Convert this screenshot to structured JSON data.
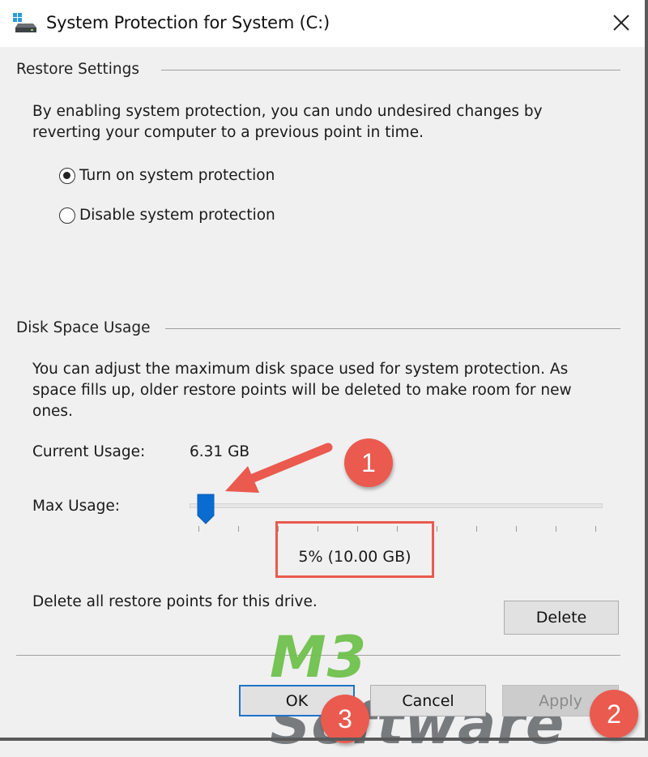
{
  "window": {
    "title": "System Protection for System (C:)",
    "icon": "drive-icon",
    "close_icon": "close-icon"
  },
  "restore_settings": {
    "heading": "Restore Settings",
    "description_line1": "By enabling system protection, you can undo undesired changes by",
    "description_line2": "reverting your computer to a previous point in time.",
    "options": [
      {
        "label": "Turn on system protection",
        "selected": true
      },
      {
        "label": "Disable system protection",
        "selected": false
      }
    ]
  },
  "disk_space_usage": {
    "heading": "Disk Space Usage",
    "description_line1": "You can adjust the maximum disk space used for system protection. As",
    "description_line2": "space fills up, older restore points will be deleted to make room for new",
    "description_line3": "ones.",
    "current_usage_label": "Current Usage:",
    "current_usage_value": "6.31 GB",
    "max_usage_label": "Max Usage:",
    "max_usage_percent": 5,
    "max_usage_display": "5% (10.00 GB)",
    "slider_tick_count": 11,
    "delete_description": "Delete all restore points for this drive.",
    "delete_label": "Delete"
  },
  "footer": {
    "ok_label": "OK",
    "cancel_label": "Cancel",
    "apply_label": "Apply",
    "apply_disabled": true
  },
  "annotations": {
    "badges": [
      "1",
      "2",
      "3"
    ],
    "color": "#ea5a4f"
  },
  "watermark": {
    "brand_part1": "M3",
    "brand_part2": " Software",
    "color_part1": "#6cc04a",
    "color_part2": "#6d7275"
  },
  "colors": {
    "accent": "#0a6bd1",
    "default_button_border": "#1e73c8",
    "background": "#f0f0f0"
  }
}
